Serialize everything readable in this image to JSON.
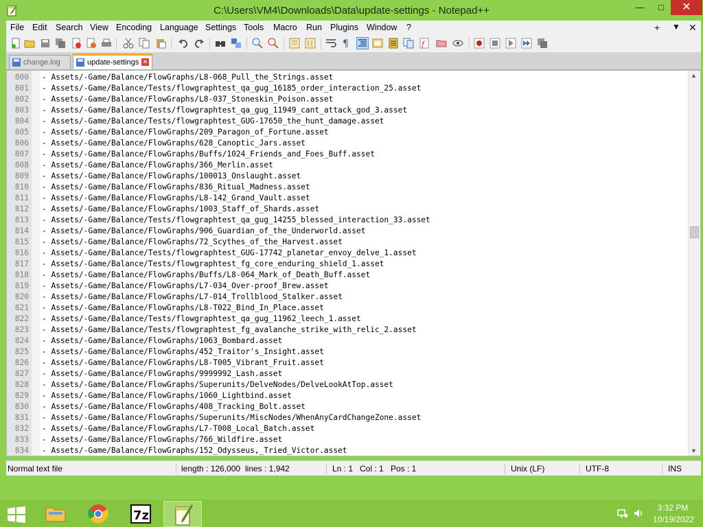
{
  "window": {
    "title": "C:\\Users\\VM4\\Downloads\\Data\\update-settings - Notepad++",
    "minimize_glyph": "—",
    "maximize_glyph": "□",
    "close_glyph": "✕"
  },
  "menu": {
    "items": [
      "File",
      "Edit",
      "Search",
      "View",
      "Encoding",
      "Language",
      "Settings",
      "Tools",
      "Macro",
      "Run",
      "Plugins",
      "Window",
      "?"
    ],
    "extra": [
      "+",
      "▼",
      "✕"
    ]
  },
  "toolbar": {
    "icons": [
      "new-file-icon",
      "open-file-icon",
      "save-icon",
      "save-all-icon",
      "close-icon",
      "close-all-icon",
      "print-icon",
      "cut-icon",
      "copy-icon",
      "paste-icon",
      "undo-icon",
      "redo-icon",
      "find-icon",
      "replace-icon",
      "zoom-in-icon",
      "zoom-out-icon",
      "sync-vertical-icon",
      "sync-horizontal-icon",
      "word-wrap-icon",
      "show-all-chars-icon",
      "indent-guide-icon",
      "user-language-icon",
      "doc-map-icon",
      "doc-list-icon",
      "function-list-icon",
      "folder-workspace-icon",
      "monitoring-icon",
      "record-macro-icon",
      "stop-macro-icon",
      "play-macro-icon",
      "run-macro-multiple-icon",
      "save-macro-icon"
    ]
  },
  "tabs": [
    {
      "label": "change.log",
      "active": false
    },
    {
      "label": "update-settings",
      "active": true
    }
  ],
  "editor": {
    "lines": [
      {
        "num": "800",
        "text": "- Assets/-Game/Balance/FlowGraphs/L8-068_Pull_the_Strings.asset"
      },
      {
        "num": "801",
        "text": "- Assets/-Game/Balance/Tests/flowgraphtest_qa_gug_16185_order_interaction_25.asset"
      },
      {
        "num": "802",
        "text": "- Assets/-Game/Balance/FlowGraphs/L8-037_Stoneskin_Poison.asset"
      },
      {
        "num": "803",
        "text": "- Assets/-Game/Balance/Tests/flowgraphtest_qa_gug_11949_cant_attack_god_3.asset"
      },
      {
        "num": "804",
        "text": "- Assets/-Game/Balance/Tests/flowgraphtest_GUG-17650_the_hunt_damage.asset"
      },
      {
        "num": "805",
        "text": "- Assets/-Game/Balance/FlowGraphs/209_Paragon_of_Fortune.asset"
      },
      {
        "num": "806",
        "text": "- Assets/-Game/Balance/FlowGraphs/628_Canoptic_Jars.asset"
      },
      {
        "num": "807",
        "text": "- Assets/-Game/Balance/FlowGraphs/Buffs/1024_Friends_and_Foes_Buff.asset"
      },
      {
        "num": "808",
        "text": "- Assets/-Game/Balance/FlowGraphs/366_Merlin.asset"
      },
      {
        "num": "809",
        "text": "- Assets/-Game/Balance/FlowGraphs/100013_Onslaught.asset"
      },
      {
        "num": "810",
        "text": "- Assets/-Game/Balance/FlowGraphs/836_Ritual_Madness.asset"
      },
      {
        "num": "811",
        "text": "- Assets/-Game/Balance/FlowGraphs/L8-142_Grand_Vault.asset"
      },
      {
        "num": "812",
        "text": "- Assets/-Game/Balance/FlowGraphs/1003_Staff_of_Shards.asset"
      },
      {
        "num": "813",
        "text": "- Assets/-Game/Balance/Tests/flowgraphtest_qa_gug_14255_blessed_interaction_33.asset"
      },
      {
        "num": "814",
        "text": "- Assets/-Game/Balance/FlowGraphs/906_Guardian_of_the_Underworld.asset"
      },
      {
        "num": "815",
        "text": "- Assets/-Game/Balance/FlowGraphs/72_Scythes_of_the_Harvest.asset"
      },
      {
        "num": "816",
        "text": "- Assets/-Game/Balance/Tests/flowgraphtest_GUG-17742_planetar_envoy_delve_1.asset"
      },
      {
        "num": "817",
        "text": "- Assets/-Game/Balance/Tests/flowgraphtest_fg_core_enduring_shield_1.asset"
      },
      {
        "num": "818",
        "text": "- Assets/-Game/Balance/FlowGraphs/Buffs/L8-064_Mark_of_Death_Buff.asset"
      },
      {
        "num": "819",
        "text": "- Assets/-Game/Balance/FlowGraphs/L7-034_Over-proof_Brew.asset"
      },
      {
        "num": "820",
        "text": "- Assets/-Game/Balance/FlowGraphs/L7-014_Trollblood_Stalker.asset"
      },
      {
        "num": "821",
        "text": "- Assets/-Game/Balance/FlowGraphs/L8-T022_Bind_In_Place.asset"
      },
      {
        "num": "822",
        "text": "- Assets/-Game/Balance/Tests/flowgraphtest_qa_gug_11962_leech_1.asset"
      },
      {
        "num": "823",
        "text": "- Assets/-Game/Balance/Tests/flowgraphtest_fg_avalanche_strike_with_relic_2.asset"
      },
      {
        "num": "824",
        "text": "- Assets/-Game/Balance/FlowGraphs/1063_Bombard.asset"
      },
      {
        "num": "825",
        "text": "- Assets/-Game/Balance/FlowGraphs/452_Traitor's_Insight.asset"
      },
      {
        "num": "826",
        "text": "- Assets/-Game/Balance/FlowGraphs/L8-T005_Vibrant_Fruit.asset"
      },
      {
        "num": "827",
        "text": "- Assets/-Game/Balance/FlowGraphs/9999992_Lash.asset"
      },
      {
        "num": "828",
        "text": "- Assets/-Game/Balance/FlowGraphs/Superunits/DelveNodes/DelveLookAtTop.asset"
      },
      {
        "num": "829",
        "text": "- Assets/-Game/Balance/FlowGraphs/1060_Lightbind.asset"
      },
      {
        "num": "830",
        "text": "- Assets/-Game/Balance/FlowGraphs/408_Tracking_Bolt.asset"
      },
      {
        "num": "831",
        "text": "- Assets/-Game/Balance/FlowGraphs/Superunits/MiscNodes/WhenAnyCardChangeZone.asset"
      },
      {
        "num": "832",
        "text": "- Assets/-Game/Balance/FlowGraphs/L7-T008_Local_Batch.asset"
      },
      {
        "num": "833",
        "text": "- Assets/-Game/Balance/FlowGraphs/766_Wildfire.asset"
      },
      {
        "num": "834",
        "text": "- Assets/-Game/Balance/FlowGraphs/152_Odysseus,_Tried_Victor.asset"
      }
    ]
  },
  "status": {
    "file_type": "Normal text file",
    "length": "length : 126,000",
    "lines": "lines : 1,942",
    "ln": "Ln : 1",
    "col": "Col : 1",
    "pos": "Pos : 1",
    "eol": "Unix (LF)",
    "encoding": "UTF-8",
    "mode": "INS"
  },
  "taskbar": {
    "time": "3:32 PM",
    "date": "10/19/2022",
    "apps": [
      "file-explorer",
      "chrome",
      "7zip",
      "notepad-plus-plus"
    ]
  },
  "colors": {
    "window_frame": "#8fd14f",
    "taskbar": "#86c53f",
    "active_tab_accent": "#f4a62a",
    "close_button": "#c7302a"
  }
}
